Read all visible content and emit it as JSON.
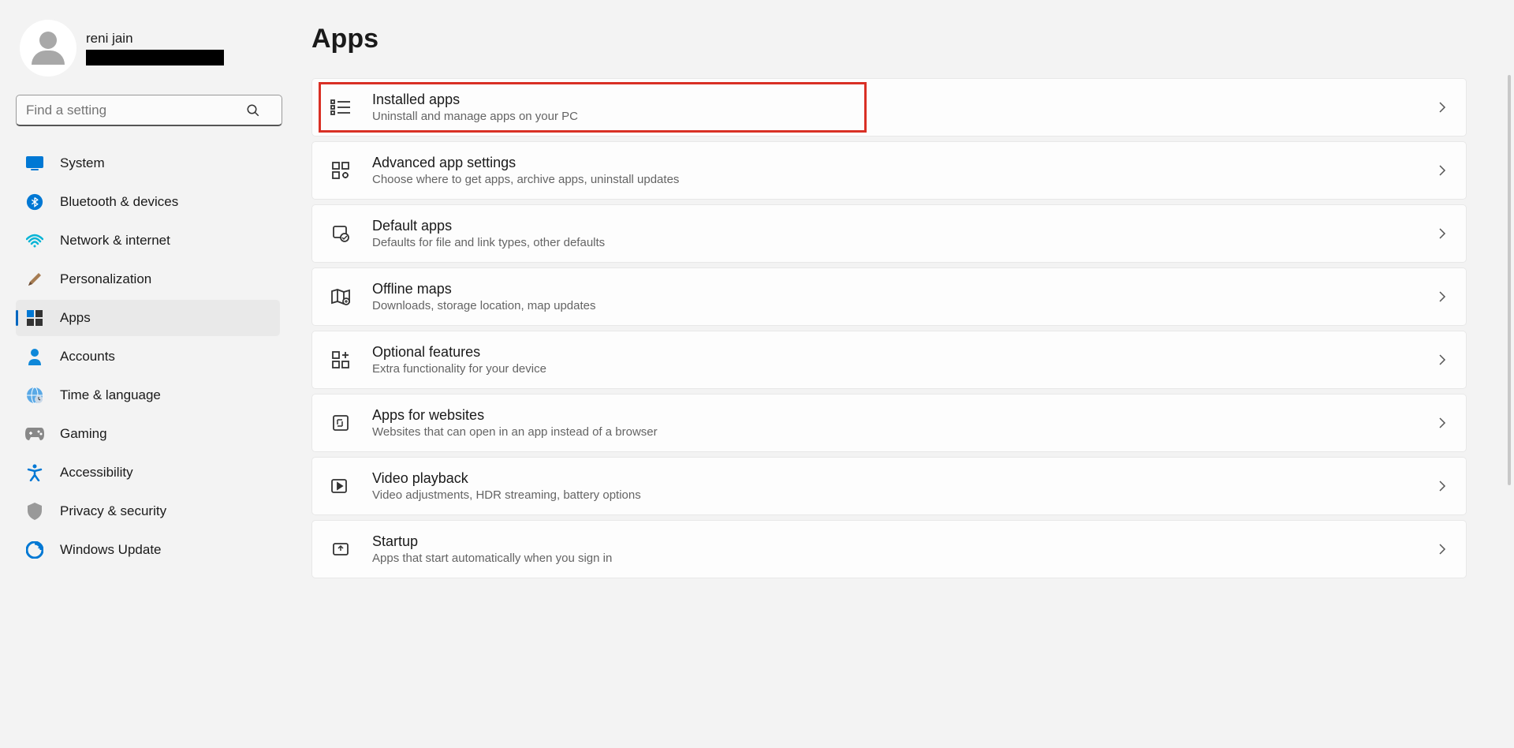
{
  "profile": {
    "name": "reni jain"
  },
  "search": {
    "placeholder": "Find a setting"
  },
  "sidebar": {
    "items": [
      {
        "label": "System",
        "icon": "🖥️",
        "active": false
      },
      {
        "label": "Bluetooth & devices",
        "icon": "bt",
        "active": false
      },
      {
        "label": "Network & internet",
        "icon": "📶",
        "active": false
      },
      {
        "label": "Personalization",
        "icon": "🖌️",
        "active": false
      },
      {
        "label": "Apps",
        "icon": "apps",
        "active": true
      },
      {
        "label": "Accounts",
        "icon": "👤",
        "active": false
      },
      {
        "label": "Time & language",
        "icon": "🌐",
        "active": false
      },
      {
        "label": "Gaming",
        "icon": "🎮",
        "active": false
      },
      {
        "label": "Accessibility",
        "icon": "♿",
        "active": false
      },
      {
        "label": "Privacy & security",
        "icon": "🛡️",
        "active": false
      },
      {
        "label": "Windows Update",
        "icon": "🔄",
        "active": false
      }
    ]
  },
  "page": {
    "title": "Apps"
  },
  "cards": [
    {
      "title": "Installed apps",
      "desc": "Uninstall and manage apps on your PC",
      "highlighted": true
    },
    {
      "title": "Advanced app settings",
      "desc": "Choose where to get apps, archive apps, uninstall updates",
      "highlighted": false
    },
    {
      "title": "Default apps",
      "desc": "Defaults for file and link types, other defaults",
      "highlighted": false
    },
    {
      "title": "Offline maps",
      "desc": "Downloads, storage location, map updates",
      "highlighted": false
    },
    {
      "title": "Optional features",
      "desc": "Extra functionality for your device",
      "highlighted": false
    },
    {
      "title": "Apps for websites",
      "desc": "Websites that can open in an app instead of a browser",
      "highlighted": false
    },
    {
      "title": "Video playback",
      "desc": "Video adjustments, HDR streaming, battery options",
      "highlighted": false
    },
    {
      "title": "Startup",
      "desc": "Apps that start automatically when you sign in",
      "highlighted": false
    }
  ]
}
